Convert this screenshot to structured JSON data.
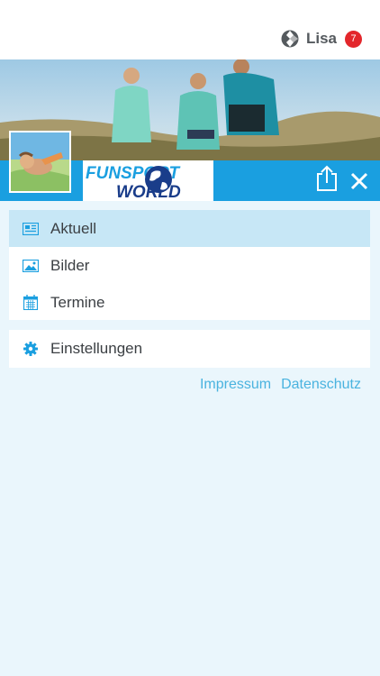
{
  "header": {
    "user_name": "Lisa",
    "notification_count": "7"
  },
  "brand": {
    "logo_line1": "FUNSPORT",
    "logo_line2": "WORLD"
  },
  "menu": {
    "items": [
      {
        "label": "Aktuell",
        "icon": "newspaper-icon",
        "active": true
      },
      {
        "label": "Bilder",
        "icon": "image-icon",
        "active": false
      },
      {
        "label": "Termine",
        "icon": "calendar-icon",
        "active": false
      }
    ],
    "settings": {
      "label": "Einstellungen",
      "icon": "gear-icon"
    }
  },
  "footer": {
    "impressum": "Impressum",
    "datenschutz": "Datenschutz"
  },
  "colors": {
    "accent": "#1a9fe0",
    "active_item_bg": "#c7e7f6",
    "page_bg": "#eaf6fc",
    "badge": "#e3262b",
    "link": "#4ab3df"
  }
}
